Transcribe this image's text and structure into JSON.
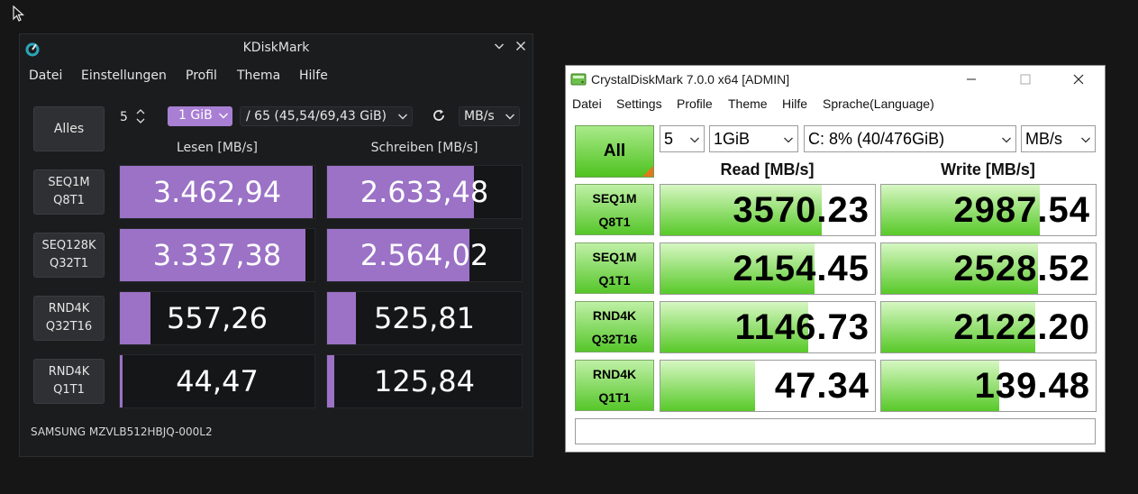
{
  "kdiskmark": {
    "title": "KDiskMark",
    "icons": {
      "app": "gauge-icon",
      "minimize": "chevron-down-icon",
      "close": "close-icon"
    },
    "menu": [
      "Datei",
      "Einstellungen",
      "Profil",
      "Thema",
      "Hilfe"
    ],
    "all_button": "Alles",
    "runs": "5",
    "size": "1 GiB",
    "drive": "/ 65 (45,54/69,43 GiB)",
    "unit": "MB/s",
    "read_header": "Lesen [MB/s]",
    "write_header": "Schreiben [MB/s]",
    "bar_max": 3500,
    "rows": [
      {
        "line1": "SEQ1M",
        "line2": "Q8T1",
        "read": "3.462,94",
        "write": "2.633,48",
        "read_num": 3462.94,
        "write_num": 2633.48
      },
      {
        "line1": "SEQ128K",
        "line2": "Q32T1",
        "read": "3.337,38",
        "write": "2.564,02",
        "read_num": 3337.38,
        "write_num": 2564.02
      },
      {
        "line1": "RND4K",
        "line2": "Q32T16",
        "read": "557,26",
        "write": "525,81",
        "read_num": 557.26,
        "write_num": 525.81
      },
      {
        "line1": "RND4K",
        "line2": "Q1T1",
        "read": "44,47",
        "write": "125,84",
        "read_num": 44.47,
        "write_num": 125.84
      }
    ],
    "device": "SAMSUNG MZVLB512HBJQ-000L2",
    "colors": {
      "background": "#1b1c1e",
      "bar": "#9b72c6",
      "accent": "#a97fd4"
    }
  },
  "crystaldiskmark": {
    "title": "CrystalDiskMark 7.0.0 x64 [ADMIN]",
    "icons": {
      "app": "disk-icon",
      "minimize": "minimize-icon",
      "maximize": "maximize-icon",
      "close": "close-icon"
    },
    "menu": [
      "Datei",
      "Settings",
      "Profile",
      "Theme",
      "Hilfe",
      "Sprache(Language)"
    ],
    "all_button": "All",
    "runs": "5",
    "size": "1GiB",
    "drive": "C: 8% (40/476GiB)",
    "unit": "MB/s",
    "read_header": "Read [MB/s]",
    "write_header": "Write [MB/s]",
    "rows": [
      {
        "line1": "SEQ1M",
        "line2": "Q8T1",
        "read": "3570.23",
        "write": "2987.54",
        "read_fill": 0.75,
        "write_fill": 0.74
      },
      {
        "line1": "SEQ1M",
        "line2": "Q1T1",
        "read": "2154.45",
        "write": "2528.52",
        "read_fill": 0.72,
        "write_fill": 0.73
      },
      {
        "line1": "RND4K",
        "line2": "Q32T16",
        "read": "1146.73",
        "write": "2122.20",
        "read_fill": 0.69,
        "write_fill": 0.72
      },
      {
        "line1": "RND4K",
        "line2": "Q1T1",
        "read": "47.34",
        "write": "139.48",
        "read_fill": 0.44,
        "write_fill": 0.55
      }
    ],
    "comment": "",
    "colors": {
      "bar_top": "#d6f7c2",
      "bar_bottom": "#58c929",
      "corner": "#e2781e"
    }
  }
}
